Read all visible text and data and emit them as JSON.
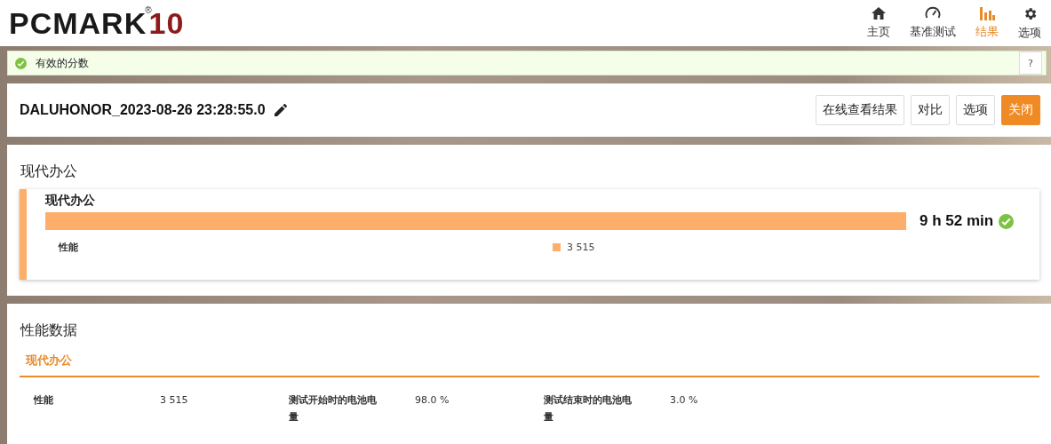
{
  "logo": {
    "text": "PCMARK",
    "number": "10",
    "mark": "®"
  },
  "nav": [
    {
      "kind": "home",
      "label": "主页",
      "selected": false
    },
    {
      "kind": "gauge",
      "label": "基准测试",
      "selected": false
    },
    {
      "kind": "chart",
      "label": "结果",
      "selected": true
    },
    {
      "kind": "gear",
      "label": "选项",
      "selected": false
    }
  ],
  "notice": {
    "text": "有效的分数",
    "valid": true,
    "help": "?"
  },
  "result": {
    "title": "DALUHONOR_2023-08-26 23:28:55.0",
    "buttons": [
      {
        "label": "在线查看结果",
        "primary": false
      },
      {
        "label": "对比",
        "primary": false
      },
      {
        "label": "选项",
        "primary": false
      },
      {
        "label": "关闭",
        "primary": true
      }
    ]
  },
  "summary": {
    "heading": "现代办公",
    "card_title": "现代办公",
    "level": 1,
    "score": "9 h 52 min",
    "passed": true,
    "metric_label": "性能",
    "metric_value": "3 515"
  },
  "details": {
    "heading": "性能数据",
    "tab": "现代办公",
    "items": [
      {
        "label": "性能",
        "value": "3 515"
      },
      {
        "label": "测试开始时的电池电量",
        "value": "98.0 %"
      },
      {
        "label": "测试结束时的电池电量",
        "value": "3.0 %"
      }
    ]
  }
}
